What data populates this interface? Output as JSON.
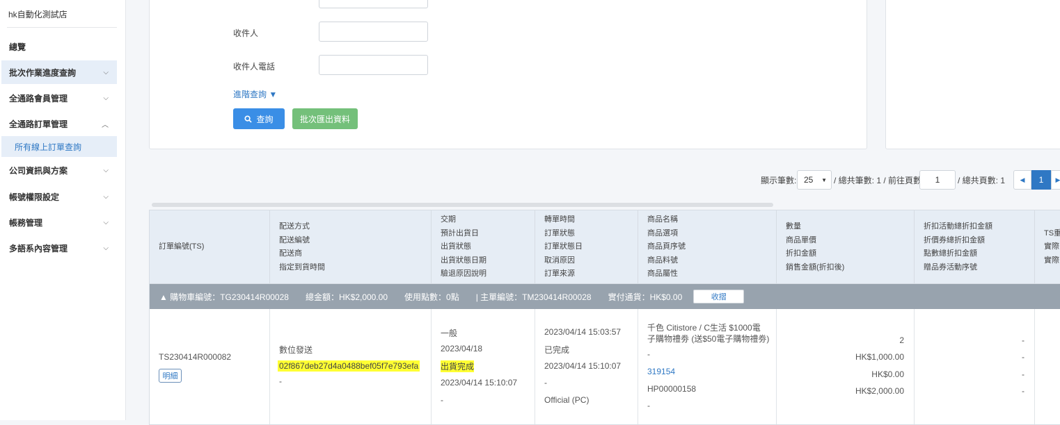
{
  "sidebar": {
    "store_name": "hk自動化測試店",
    "items": [
      {
        "label": "總覽",
        "chevron": ""
      },
      {
        "label": "批次作業進度查詢",
        "chevron": "⌵"
      },
      {
        "label": "全通路會員管理",
        "chevron": "⌵"
      },
      {
        "label": "全通路訂單管理",
        "chevron": "︿"
      },
      {
        "label": "公司資訊與方案",
        "chevron": "⌵"
      },
      {
        "label": "帳號權限設定",
        "chevron": "⌵"
      },
      {
        "label": "帳務管理",
        "chevron": "⌵"
      },
      {
        "label": "多語系內容管理",
        "chevron": "⌵"
      }
    ],
    "sub_item": "所有線上訂單查詢"
  },
  "filters": {
    "receiver_label": "收件人",
    "receiver_phone_label": "收件人電話",
    "advanced_link": "進階查詢 ▼",
    "search_button": "查詢",
    "export_button": "批次匯出資料"
  },
  "pager": {
    "rows_label": "顯示筆數:",
    "rows_value": "25",
    "total_rows": "/ 總共筆數: 1 / 前往頁數",
    "goto_value": "1",
    "total_pages": "/ 總共頁數: 1",
    "current_page": "1"
  },
  "table": {
    "headers": [
      [
        "訂單編號(TS)"
      ],
      [
        "配送方式",
        "配送編號",
        "配送商",
        "指定到貨時間"
      ],
      [
        "交期",
        "預計出貨日",
        "出貨狀態",
        "出貨狀態日期",
        "驗退原因說明"
      ],
      [
        "轉單時間",
        "訂單狀態",
        "訂單狀態日",
        "取消原因",
        "訂單來源"
      ],
      [
        "商品名稱",
        "商品選項",
        "商品頁序號",
        "商品料號",
        "商品屬性"
      ],
      [
        "數量",
        "商品單價",
        "折扣金額",
        "銷售金額(折扣後)"
      ],
      [
        "折扣活動總折扣金額",
        "折價券總折扣金額",
        "點數總折扣金額",
        "贈品券活動序號"
      ],
      [
        "TS重",
        "實際",
        "實際"
      ]
    ],
    "group": {
      "cart_no": "▲ 購物車編號：TG230414R00028",
      "total": "總金額：HK$2,000.00",
      "points": "使用點數：0點",
      "main_order": "| 主單編號：TM230414R00028",
      "paid": "實付通貨：HK$0.00",
      "collapse_button": "收摺"
    },
    "row": {
      "order_no": "TS230414R000082",
      "detail_button": "明細",
      "delivery_method": "數位發送",
      "delivery_no": "02f867deb27d4a0488bef05f7e793efa",
      "delivery_vendor": "-",
      "lead_time": "一般",
      "ship_date": "2023/04/18",
      "ship_status": "出貨完成",
      "ship_status_date": "2023/04/14 15:10:07",
      "return_reason": "-",
      "transfer_time": "2023/04/14 15:03:57",
      "order_status": "已完成",
      "order_status_date": "2023/04/14 15:10:07",
      "cancel_reason": "-",
      "order_source": "Official (PC)",
      "product_name_1": "千色 Citistore / C生活 $1000電",
      "product_name_2": "子購物禮劵 (送$50電子購物禮劵)",
      "product_option": "-",
      "product_page_no": "319154",
      "product_sku": "HP00000158",
      "product_attr": "-",
      "qty": "2",
      "unit_price": "HK$1,000.00",
      "discount": "HK$0.00",
      "sale_amount": "HK$2,000.00",
      "promo_discount": "-",
      "coupon_discount": "-",
      "points_discount": "-",
      "gift_serial": "-"
    }
  },
  "colors": {
    "primary": "#3a8ee6",
    "export": "#74c07a",
    "highlight": "#ffff33",
    "group_bar": "#98a3ae",
    "header_bg": "#e6edf5"
  }
}
